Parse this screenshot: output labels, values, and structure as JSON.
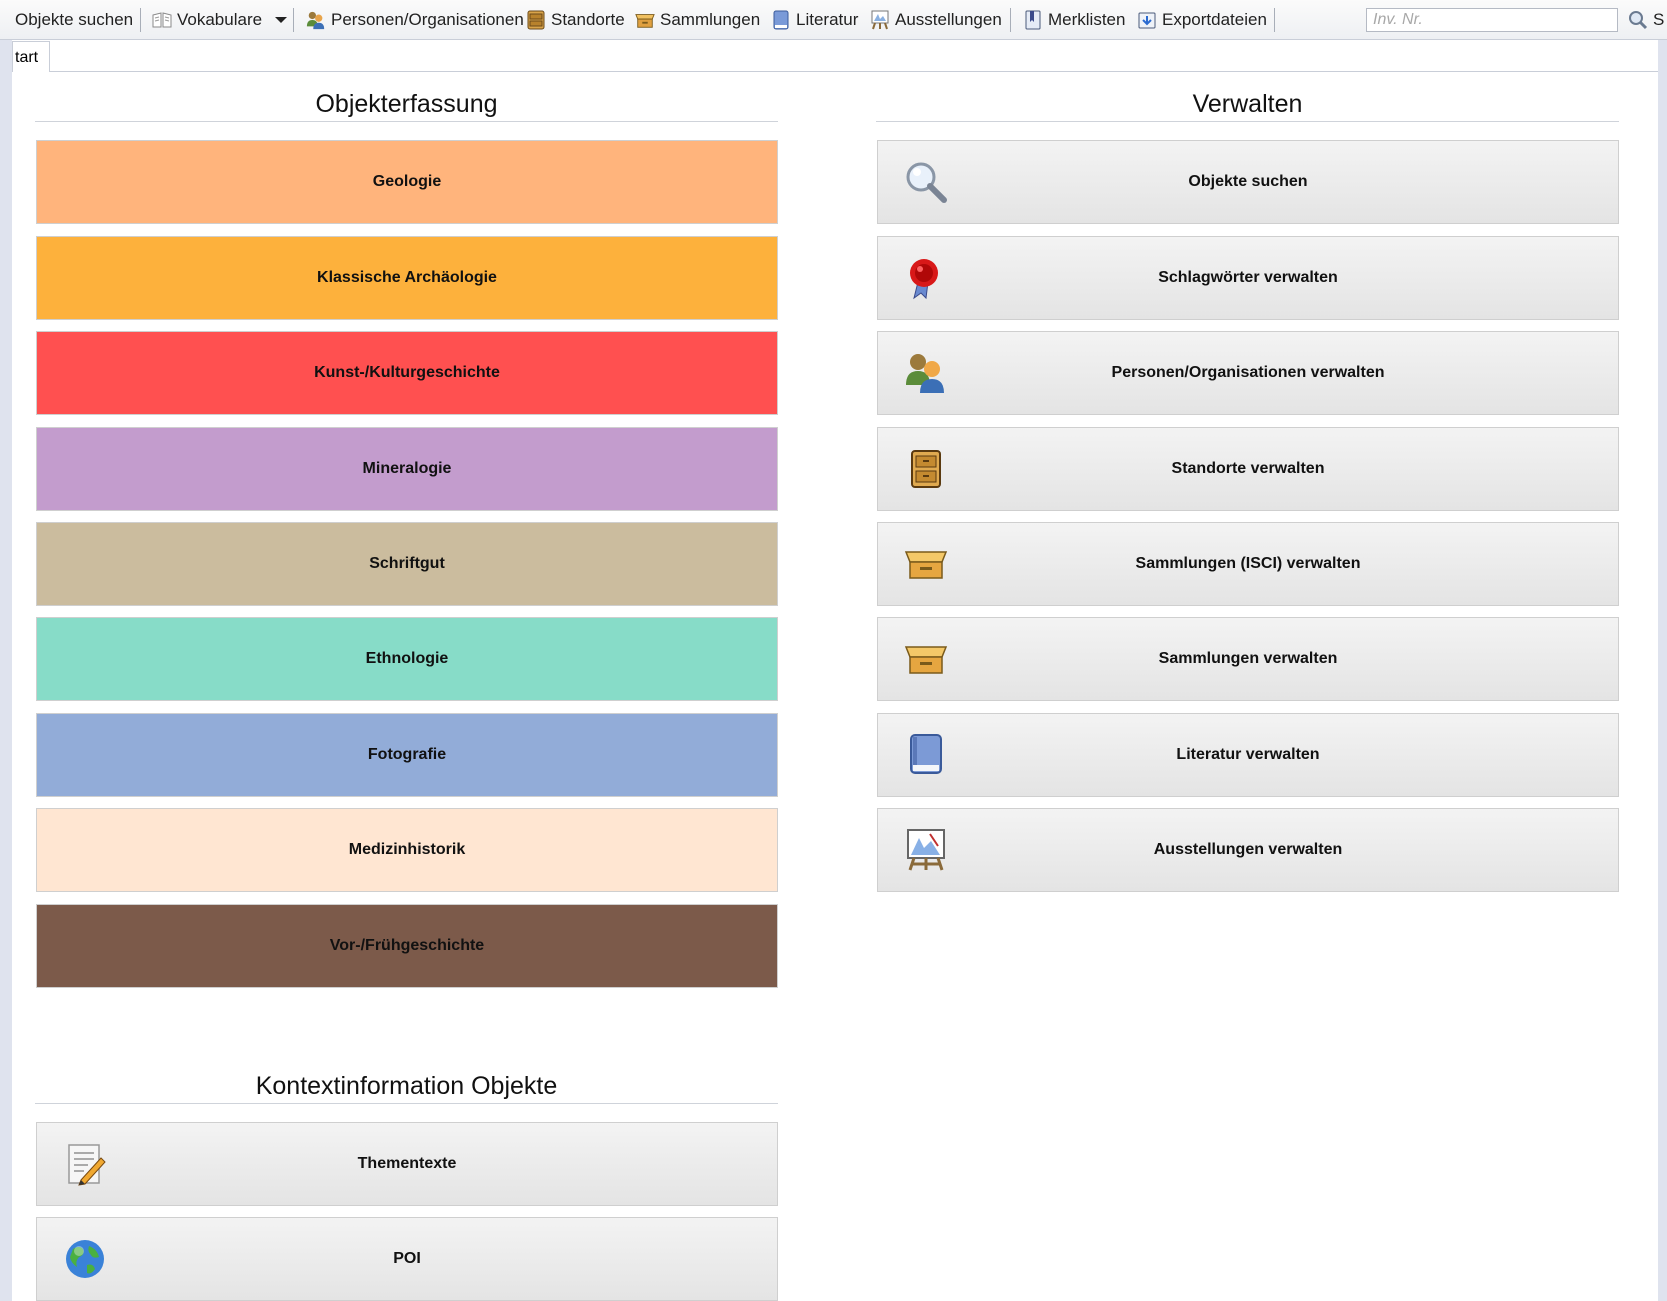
{
  "toolbar": {
    "search_objects": "Objekte suchen",
    "vocabularies": "Vokabulare",
    "persons": "Personen/Organisationen",
    "locations": "Standorte",
    "collections": "Sammlungen",
    "literature": "Literatur",
    "exhibitions": "Ausstellungen",
    "watchlists": "Merklisten",
    "exports": "Exportdateien",
    "inv_placeholder": "Inv. Nr.",
    "inv_value": "",
    "search_cut_label": "S"
  },
  "tabs": {
    "start": "tart"
  },
  "sections": {
    "capture": {
      "title": "Objekterfassung",
      "items": [
        {
          "label": "Geologie",
          "color": "#ffb47c"
        },
        {
          "label": "Klassische Archäologie",
          "color": "#fdb13c"
        },
        {
          "label": "Kunst-/Kulturgeschichte",
          "color": "#ff5050"
        },
        {
          "label": "Mineralogie",
          "color": "#c39ccd"
        },
        {
          "label": "Schriftgut",
          "color": "#cbbc9e"
        },
        {
          "label": "Ethnologie",
          "color": "#87dcc8"
        },
        {
          "label": "Fotografie",
          "color": "#92acd8"
        },
        {
          "label": "Medizinhistorik",
          "color": "#ffe6d2"
        },
        {
          "label": "Vor-/Frühgeschichte",
          "color": "#7c5a4a"
        }
      ]
    },
    "manage": {
      "title": "Verwalten",
      "items": [
        {
          "label": "Objekte suchen",
          "icon": "magnifier-icon"
        },
        {
          "label": "Schlagwörter verwalten",
          "icon": "seal-icon"
        },
        {
          "label": "Personen/Organisationen verwalten",
          "icon": "people-icon"
        },
        {
          "label": "Standorte verwalten",
          "icon": "cabinet-icon"
        },
        {
          "label": "Sammlungen (ISCI) verwalten",
          "icon": "box-icon"
        },
        {
          "label": "Sammlungen verwalten",
          "icon": "box-icon"
        },
        {
          "label": "Literatur verwalten",
          "icon": "book-icon"
        },
        {
          "label": "Ausstellungen verwalten",
          "icon": "easel-icon"
        }
      ]
    },
    "context": {
      "title": "Kontextinformation Objekte",
      "items": [
        {
          "label": "Thementexte",
          "icon": "note-pencil-icon"
        },
        {
          "label": "POI",
          "icon": "globe-icon"
        }
      ]
    }
  }
}
